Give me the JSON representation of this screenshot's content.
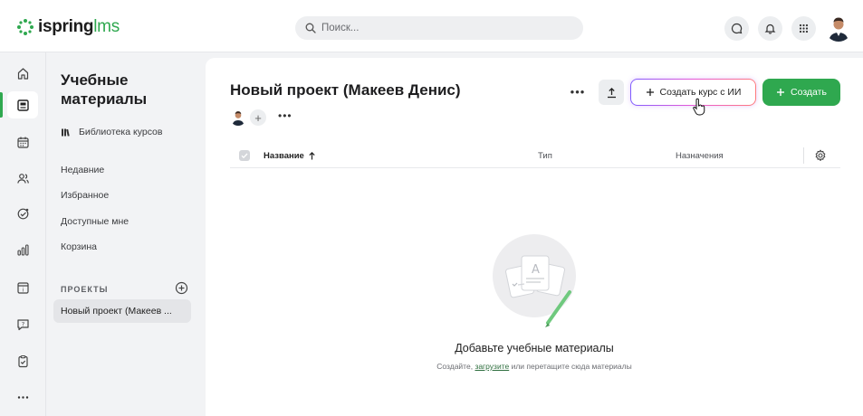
{
  "brand": {
    "name_part1": "ispring",
    "name_part2": "lms",
    "accent": "#2fa84f"
  },
  "search": {
    "placeholder": "Поиск..."
  },
  "topbar_icons": [
    "chat-icon",
    "bell-icon",
    "apps-grid-icon",
    "user-avatar"
  ],
  "rail": [
    "home-icon",
    "materials-icon",
    "calendar-icon",
    "users-icon",
    "achievements-icon",
    "reports-icon",
    "courses-icon",
    "chat-icon",
    "assignments-icon",
    "more-icon"
  ],
  "sidebar": {
    "title": "Учебные материалы",
    "library": "Библиотека курсов",
    "links": [
      "Недавние",
      "Избранное",
      "Доступные мне",
      "Корзина"
    ],
    "projects_header": "ПРОЕКТЫ",
    "project_item": "Новый проект (Макеев ..."
  },
  "main": {
    "title": "Новый проект (Макеев Денис)",
    "dots": "•••",
    "plus": "+",
    "create_ai_label": "Создать курс с ИИ",
    "create_label": "Создать",
    "columns": {
      "name": "Название",
      "type": "Тип",
      "assignments": "Назначения"
    },
    "empty_title": "Добавьте учебные материалы",
    "empty_sub_1": "Создайте, ",
    "empty_sub_link": "загрузите",
    "empty_sub_2": " или перетащите сюда материалы"
  }
}
